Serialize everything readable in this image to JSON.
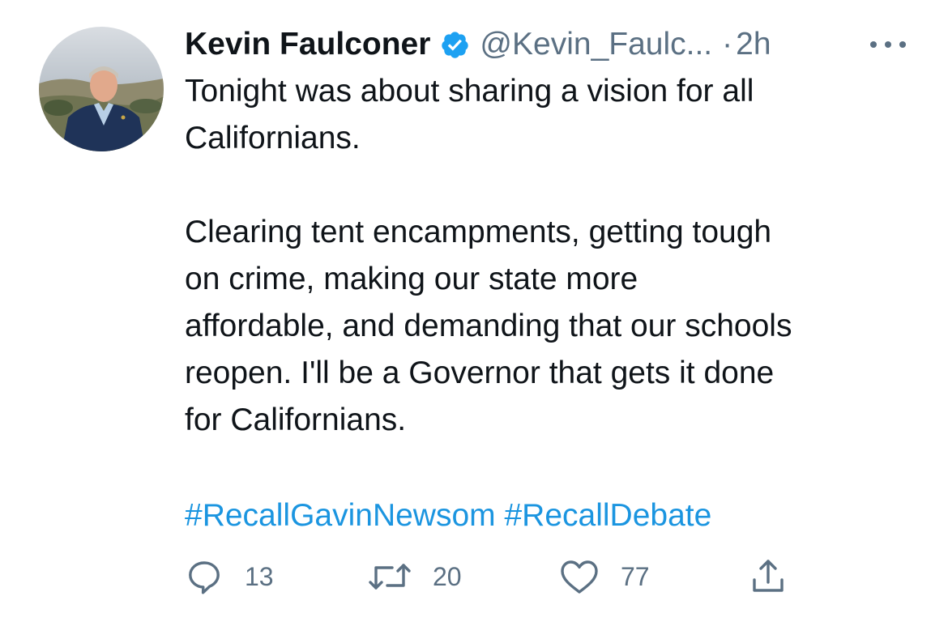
{
  "tweet": {
    "author_name": "Kevin Faulconer",
    "handle": "@Kevin_Faulc...",
    "separator": "·",
    "time": "2h",
    "verified": true,
    "text_lines": [
      "Tonight was about sharing a vision for all",
      "Californians.",
      "",
      "Clearing tent encampments, getting tough",
      "on crime, making our state more",
      "affordable, and demanding that our schools",
      "reopen. I'll be a Governor that gets it done",
      "for Californians."
    ],
    "hashtags": [
      "#RecallGavinNewsom",
      "#RecallDebate"
    ],
    "stats": {
      "replies": "13",
      "retweets": "20",
      "likes": "77"
    }
  },
  "icons": {
    "more": "more-horizontal-icon",
    "verified": "verified-badge-icon",
    "reply": "reply-icon",
    "retweet": "retweet-icon",
    "like": "heart-icon",
    "share": "share-icon"
  },
  "colors": {
    "text": "#0f1419",
    "secondary": "#5b7083",
    "link": "#1b95e0",
    "verified": "#1da1f2"
  }
}
